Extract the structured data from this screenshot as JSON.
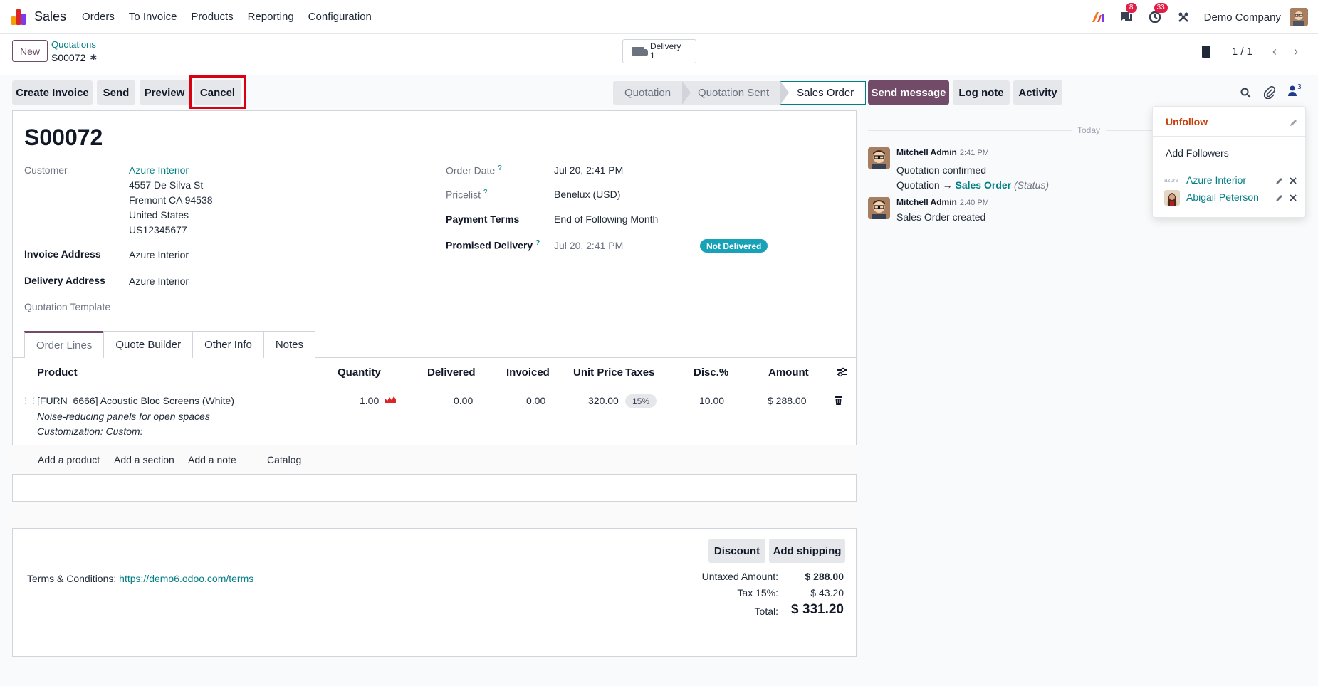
{
  "navbar": {
    "app_name": "Sales",
    "menu": [
      "Orders",
      "To Invoice",
      "Products",
      "Reporting",
      "Configuration"
    ],
    "badges": {
      "messages": "8",
      "activities": "33"
    },
    "company": "Demo Company"
  },
  "control": {
    "new_label": "New",
    "breadcrumb_parent": "Quotations",
    "breadcrumb_current": "S00072",
    "delivery_label": "Delivery",
    "delivery_count": "1",
    "pager_value": "1 / 1"
  },
  "actions": {
    "create_invoice": "Create Invoice",
    "send": "Send",
    "preview": "Preview",
    "cancel": "Cancel"
  },
  "statusbar": {
    "stages": [
      "Quotation",
      "Quotation Sent",
      "Sales Order"
    ],
    "active": "Sales Order"
  },
  "form": {
    "title": "S00072",
    "customer_label": "Customer",
    "customer_name": "Azure Interior",
    "customer_street": "4557 De Silva St",
    "customer_city": "Fremont CA 94538",
    "customer_country": "United States",
    "customer_vat": "US12345677",
    "invoice_address_label": "Invoice Address",
    "invoice_address": "Azure Interior",
    "delivery_address_label": "Delivery Address",
    "delivery_address": "Azure Interior",
    "quotation_template_label": "Quotation Template",
    "order_date_label": "Order Date",
    "order_date": "Jul 20, 2:41 PM",
    "pricelist_label": "Pricelist",
    "pricelist": "Benelux (USD)",
    "payment_terms_label": "Payment Terms",
    "payment_terms": "End of Following Month",
    "promised_delivery_label": "Promised Delivery",
    "promised_delivery": "Jul 20, 2:41 PM",
    "delivery_status": "Not Delivered",
    "help_mark": "?"
  },
  "tabs": [
    "Order Lines",
    "Quote Builder",
    "Other Info",
    "Notes"
  ],
  "table": {
    "headers": [
      "Product",
      "Quantity",
      "Delivered",
      "Invoiced",
      "Unit Price",
      "Taxes",
      "Disc.%",
      "Amount"
    ],
    "rows": [
      {
        "product": "[FURN_6666] Acoustic Bloc Screens (White)",
        "description": "Noise-reducing panels for open spaces",
        "customization": "Customization: Custom:",
        "quantity": "1.00",
        "delivered": "0.00",
        "invoiced": "0.00",
        "unit_price": "320.00",
        "taxes": "15%",
        "discount": "10.00",
        "amount": "$ 288.00"
      }
    ],
    "add_product": "Add a product",
    "add_section": "Add a section",
    "add_note": "Add a note",
    "catalog": "Catalog"
  },
  "footer": {
    "discount_btn": "Discount",
    "shipping_btn": "Add shipping",
    "terms_label": "Terms & Conditions:",
    "terms_link": "https://demo6.odoo.com/terms",
    "untaxed_label": "Untaxed Amount:",
    "untaxed_value": "$ 288.00",
    "tax_label": "Tax 15%:",
    "tax_value": "$ 43.20",
    "total_label": "Total:",
    "total_value": "$ 331.20"
  },
  "chatter": {
    "send_message": "Send message",
    "log_note": "Log note",
    "activity": "Activity",
    "followers_count": "3",
    "today": "Today",
    "messages": [
      {
        "author": "Mitchell Admin",
        "time": "2:41 PM",
        "body": "Quotation confirmed",
        "change_from": "Quotation",
        "change_arrow": "→",
        "change_to": "Sales Order",
        "change_field": "(Status)"
      },
      {
        "author": "Mitchell Admin",
        "time": "2:40 PM",
        "body": "Sales Order created"
      }
    ]
  },
  "followers_dropdown": {
    "unfollow": "Unfollow",
    "add_followers": "Add Followers",
    "followers": [
      "Azure Interior",
      "Abigail Peterson"
    ],
    "logo_text": "azure"
  },
  "colors": {
    "brand": "#714B67",
    "link": "#017e84",
    "danger": "#d90012",
    "badge": "#17a2b8"
  }
}
